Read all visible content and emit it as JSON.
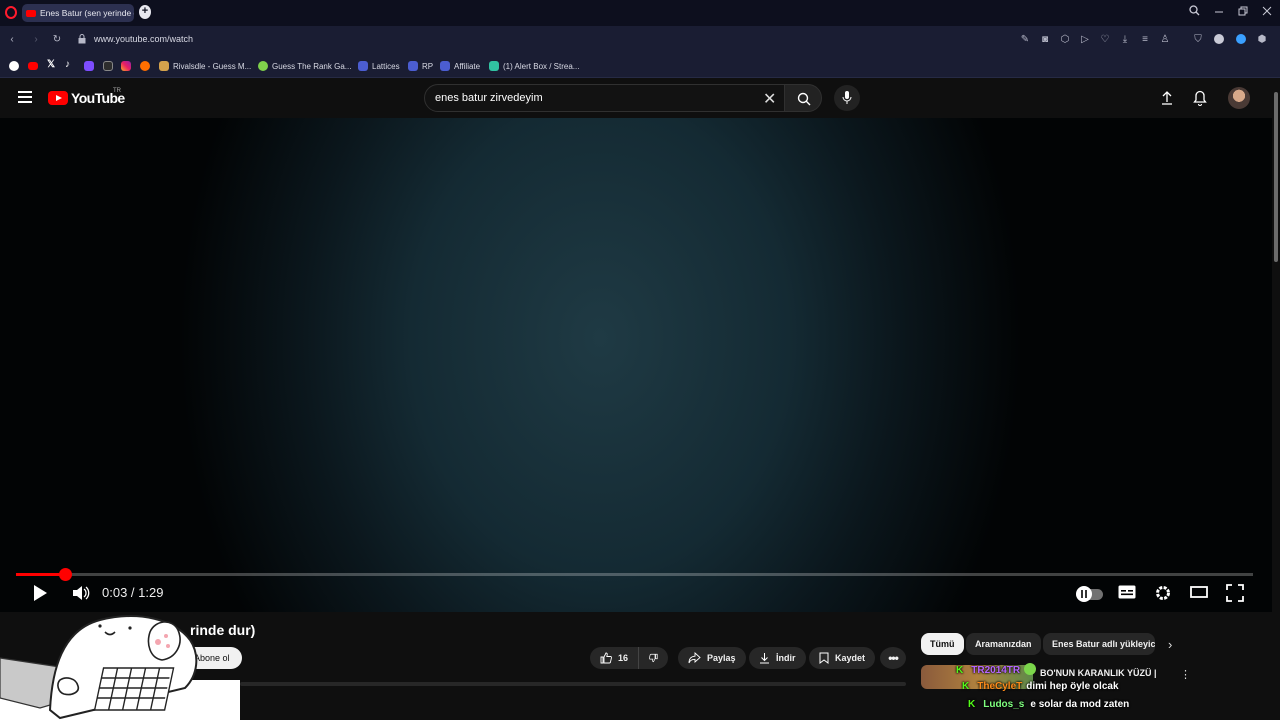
{
  "browser": {
    "tab_title": "Enes Batur (sen yerinde d",
    "new_tab_label": "+",
    "url": "www.youtube.com/watch",
    "window_controls": [
      "minimize",
      "restore",
      "close"
    ],
    "bookmarks": [
      {
        "label": "Rivalsdle - Guess M...",
        "icon": "rivalsdle-icon"
      },
      {
        "label": "Guess The Rank Ga...",
        "icon": "gtr-icon"
      },
      {
        "label": "Lattices",
        "icon": "lattices-icon"
      },
      {
        "label": "RP",
        "icon": "rp-icon"
      },
      {
        "label": "Affiliate",
        "icon": "affiliate-icon"
      },
      {
        "label": "(1) Alert Box / Strea...",
        "icon": "alertbox-icon"
      }
    ]
  },
  "youtube": {
    "logo_text": "YouTube",
    "country_code": "TR",
    "search_query": "enes batur zirvedeyim",
    "player": {
      "current_time": "0:03",
      "duration": "1:29",
      "time_display": "0:03 / 1:29",
      "progress_fraction": 0.04
    },
    "video_title_visible": "rinde dur)",
    "subscribe_label": "Abone ol",
    "actions": {
      "like_count": "16",
      "share_label": "Paylaş",
      "download_label": "İndir",
      "save_label": "Kaydet"
    },
    "chips": [
      "Tümü",
      "Aramanızdan",
      "Enes Batur adlı yükleyici"
    ],
    "recommended_title_visible": "BO'NUN KARANLIK YÜZÜ |"
  },
  "chat": [
    {
      "user": "TR2014TR",
      "user_color": "#b565ff",
      "message": ""
    },
    {
      "user": "TheCyleT",
      "user_color": "#ff8c1a",
      "message": "dimi hep öyle olcak"
    },
    {
      "user": "Ludos_s",
      "user_color": "#7fff7f",
      "message": "e solar da mod zaten"
    }
  ],
  "colors": {
    "accent_red": "#ff0000",
    "browser_bg": "#1a1d33",
    "kick_green": "#53fc18"
  }
}
